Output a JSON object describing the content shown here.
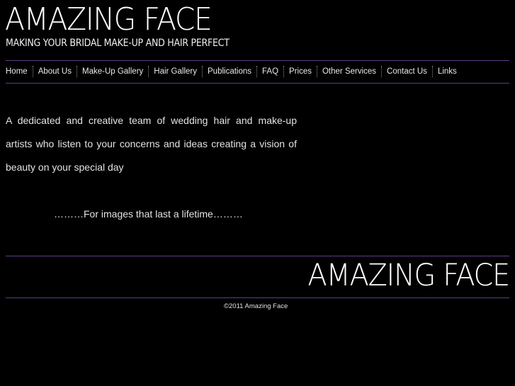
{
  "header": {
    "title": "AMAZING FACE",
    "tagline": "MAKING YOUR BRIDAL MAKE-UP AND HAIR PERFECT"
  },
  "nav": {
    "items": [
      {
        "label": "Home"
      },
      {
        "label": "About Us"
      },
      {
        "label": "Make-Up Gallery"
      },
      {
        "label": "Hair Gallery"
      },
      {
        "label": "Publications"
      },
      {
        "label": "FAQ"
      },
      {
        "label": "Prices"
      },
      {
        "label": "Other Services"
      },
      {
        "label": "Contact Us"
      },
      {
        "label": "Links"
      }
    ]
  },
  "main": {
    "intro": "A dedicated and creative team of wedding hair and make-up artists who listen to your concerns and ideas creating a vision of beauty on your special day",
    "slogan": "………For images that last a lifetime………"
  },
  "footer": {
    "logo": "AMAZING FACE",
    "copyright": "©2011 Amazing Face"
  },
  "colors": {
    "background": "#000000",
    "accent_rule": "#5e3d86",
    "text": "#e6e6e6"
  }
}
